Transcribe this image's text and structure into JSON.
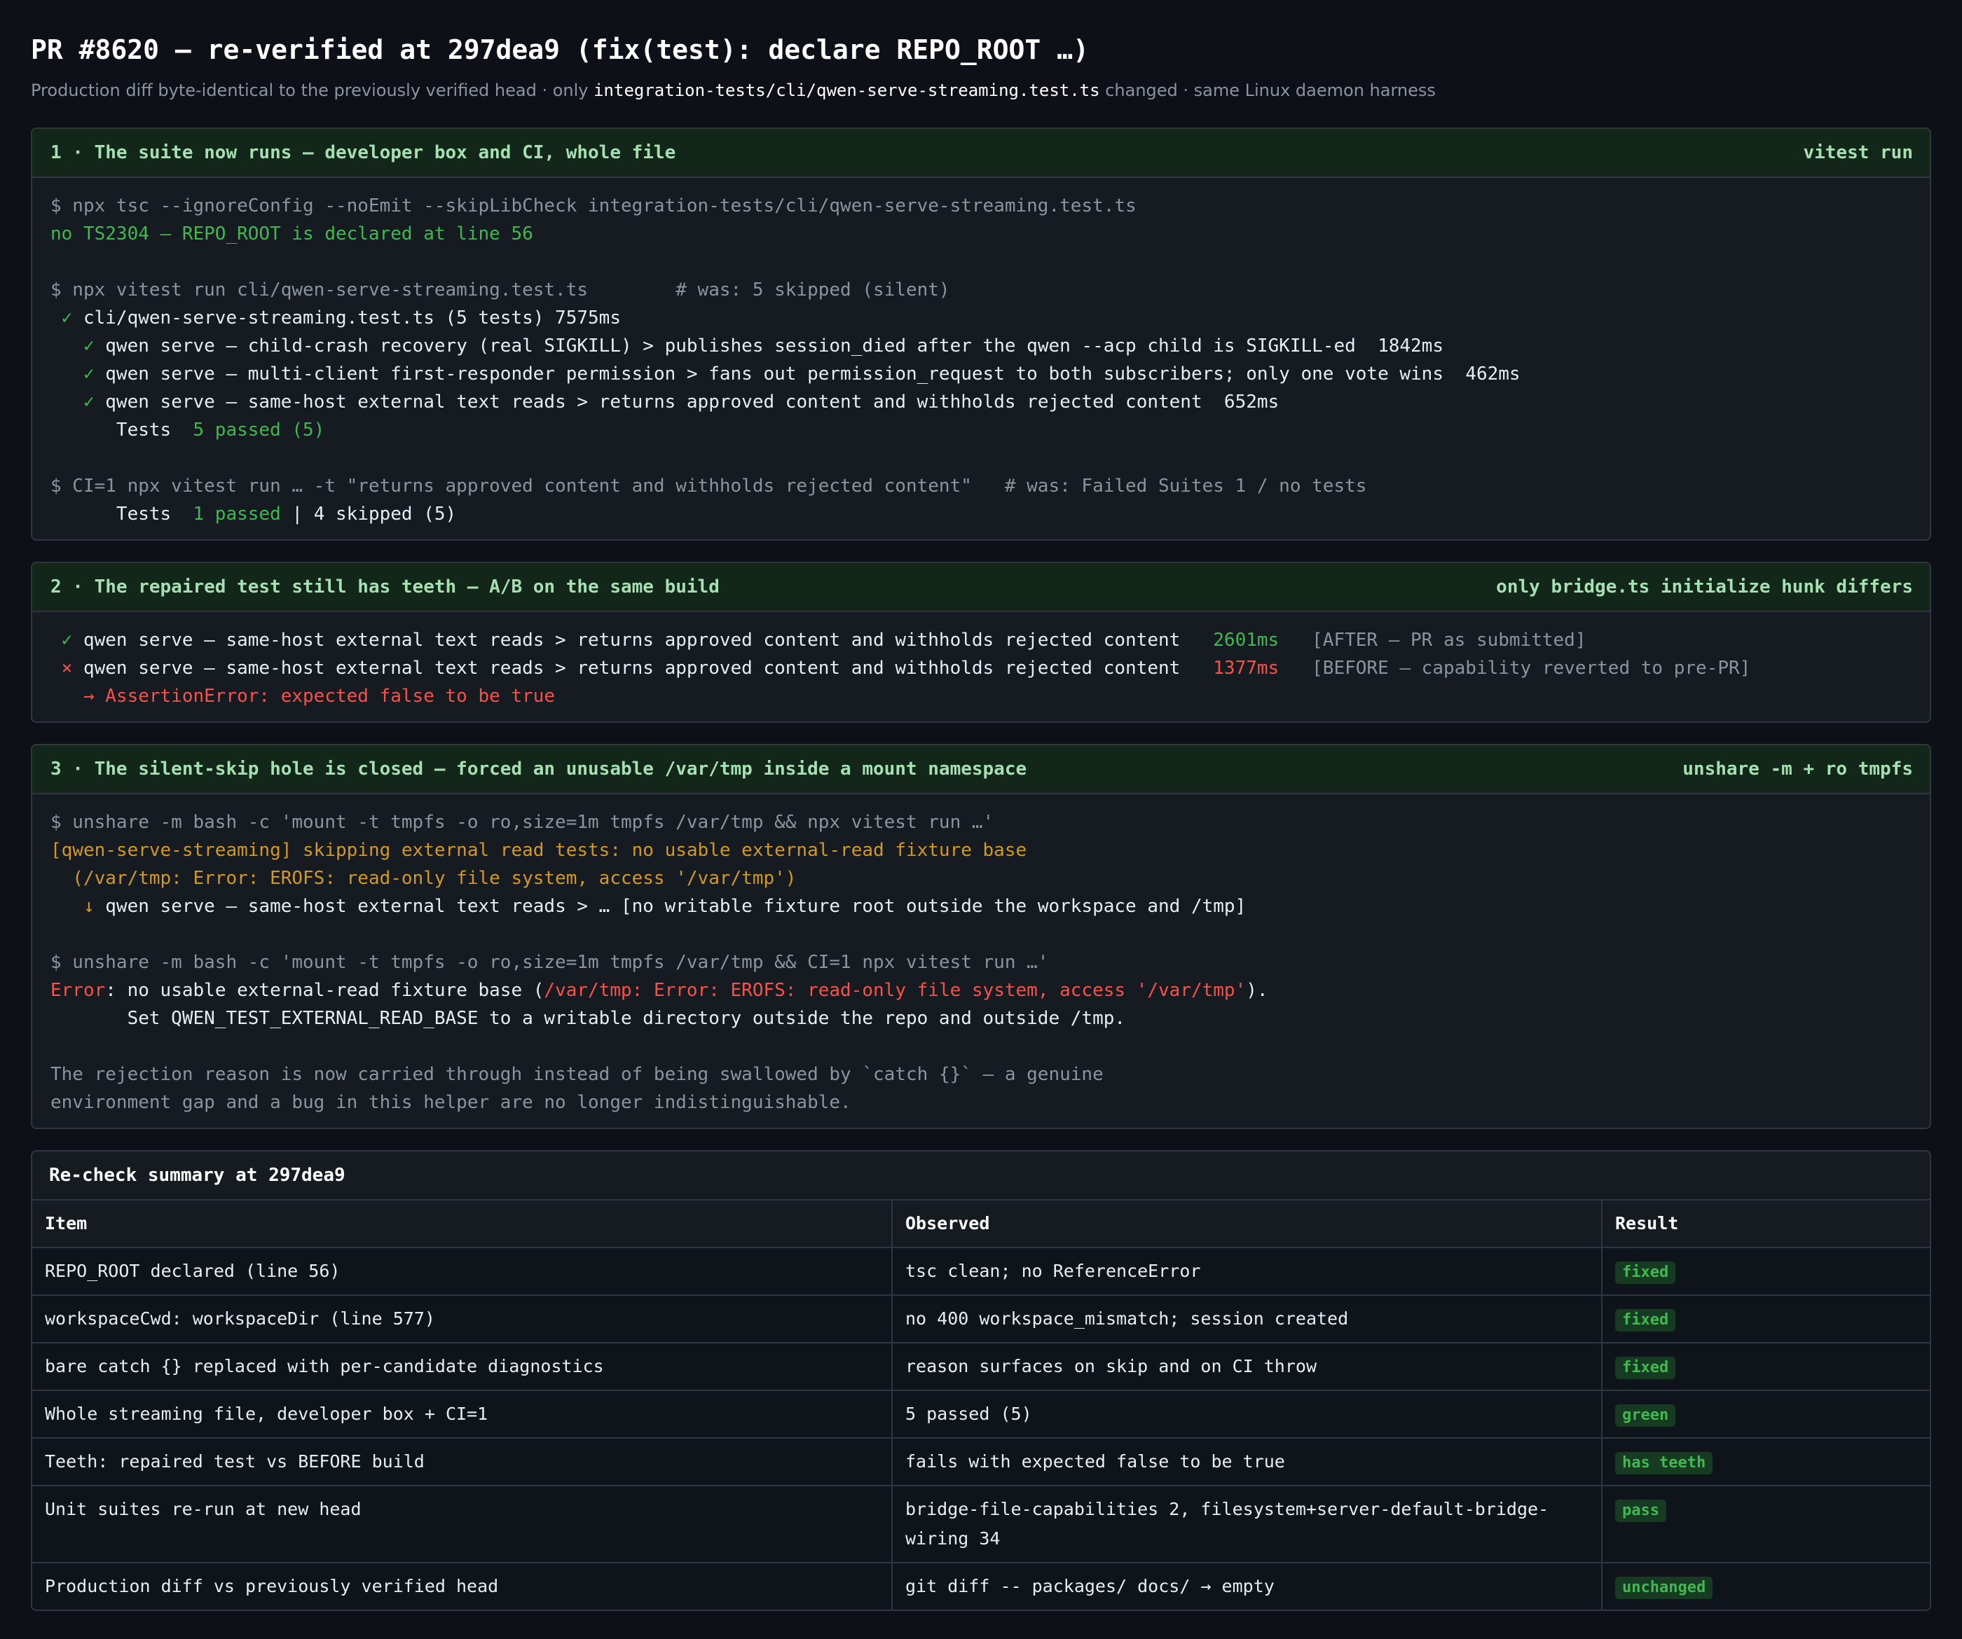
{
  "header": {
    "title": "PR #8620 — re-verified at 297dea9 (fix(test): declare REPO_ROOT …)",
    "subtitle_before": "Production diff byte-identical to the previously verified head · only ",
    "subtitle_path": "integration-tests/cli/qwen-serve-streaming.test.ts",
    "subtitle_after": " changed · same Linux daemon harness"
  },
  "section1": {
    "title": "1 · The suite now runs — developer box and CI, whole file",
    "tag": "vitest run",
    "l1": "$ npx tsc --ignoreConfig --noEmit --skipLibCheck integration-tests/cli/qwen-serve-streaming.test.ts",
    "l2": "no TS2304 — REPO_ROOT is declared at line 56",
    "l3": "$ npx vitest run cli/qwen-serve-streaming.test.ts        # was: 5 skipped (silent)",
    "l4_mark": " ✓ ",
    "l4": "cli/qwen-serve-streaming.test.ts (5 tests) 7575ms",
    "l5_mark": "   ✓ ",
    "l5": "qwen serve — child-crash recovery (real SIGKILL) > publishes session_died after the qwen --acp child is SIGKILL-ed  1842ms",
    "l6_mark": "   ✓ ",
    "l6": "qwen serve — multi-client first-responder permission > fans out permission_request to both subscribers; only one vote wins  462ms",
    "l7_mark": "   ✓ ",
    "l7": "qwen serve — same-host external text reads > returns approved content and withholds rejected content  652ms",
    "l8_label": "      Tests  ",
    "l8_value": "5 passed (5)",
    "l9": "$ CI=1 npx vitest run … -t \"returns approved content and withholds rejected content\"   # was: Failed Suites 1 / no tests",
    "l10_label": "      Tests  ",
    "l10_value": "1 passed",
    "l10_rest": " | 4 skipped (5)"
  },
  "section2": {
    "title": "2 · The repaired test still has teeth — A/B on the same build",
    "tag": "only bridge.ts initialize hunk differs",
    "l1_mark": " ✓ ",
    "l1_text": "qwen serve — same-host external text reads > returns approved content and withholds rejected content   ",
    "l1_time": "2601ms",
    "l1_note": "   [AFTER — PR as submitted]",
    "l2_mark": " × ",
    "l2_text": "qwen serve — same-host external text reads > returns approved content and withholds rejected content   ",
    "l2_time": "1377ms",
    "l2_note": "   [BEFORE — capability reverted to pre-PR]",
    "l3": "   → AssertionError: expected false to be true"
  },
  "section3": {
    "title": "3 · The silent-skip hole is closed — forced an unusable /var/tmp inside a mount namespace",
    "tag": "unshare -m + ro tmpfs",
    "l1": "$ unshare -m bash -c 'mount -t tmpfs -o ro,size=1m tmpfs /var/tmp && npx vitest run …'",
    "l2": "[qwen-serve-streaming] skipping external read tests: no usable external-read fixture base",
    "l3": "  (/var/tmp: Error: EROFS: read-only file system, access '/var/tmp')",
    "l4_mark": "   ↓ ",
    "l4": "qwen serve — same-host external text reads > … [no writable fixture root outside the workspace and /tmp]",
    "l5": "$ unshare -m bash -c 'mount -t tmpfs -o ro,size=1m tmpfs /var/tmp && CI=1 npx vitest run …'",
    "l6_err": "Error",
    "l6_mid": ": no usable external-read fixture base (",
    "l6_detail": "/var/tmp: Error: EROFS: read-only file system, access '/var/tmp'",
    "l6_end": ").",
    "l7": "       Set QWEN_TEST_EXTERNAL_READ_BASE to a writable directory outside the repo and outside /tmp.",
    "l8": "The rejection reason is now carried through instead of being swallowed by `catch {}` — a genuine",
    "l9": "environment gap and a bug in this helper are no longer indistinguishable."
  },
  "summary": {
    "title": "Re-check summary at 297dea9",
    "columns": [
      "Item",
      "Observed",
      "Result"
    ],
    "rows": [
      {
        "item": "REPO_ROOT declared (line 56)",
        "observed": "tsc clean; no ReferenceError",
        "result": "fixed"
      },
      {
        "item": "workspaceCwd: workspaceDir (line 577)",
        "observed": "no 400 workspace_mismatch; session created",
        "result": "fixed"
      },
      {
        "item": "bare catch {} replaced with per-candidate diagnostics",
        "observed": "reason surfaces on skip and on CI throw",
        "result": "fixed"
      },
      {
        "item": "Whole streaming file, developer box + CI=1",
        "observed": "5 passed (5)",
        "result": "green"
      },
      {
        "item": "Teeth: repaired test vs BEFORE build",
        "observed": "fails with expected false to be true",
        "result": "has teeth"
      },
      {
        "item": "Unit suites re-run at new head",
        "observed": "bridge-file-capabilities 2, filesystem+server-default-bridge-wiring 34",
        "result": "pass"
      },
      {
        "item": "Production diff vs previously verified head",
        "observed": "git diff -- packages/ docs/ → empty",
        "result": "unchanged"
      }
    ]
  },
  "colors": {
    "background": "#0d1117",
    "card": "#161b22",
    "card_header": "#12261a",
    "pass": "#3fb950",
    "fail": "#f85149",
    "warn": "#d29922"
  }
}
